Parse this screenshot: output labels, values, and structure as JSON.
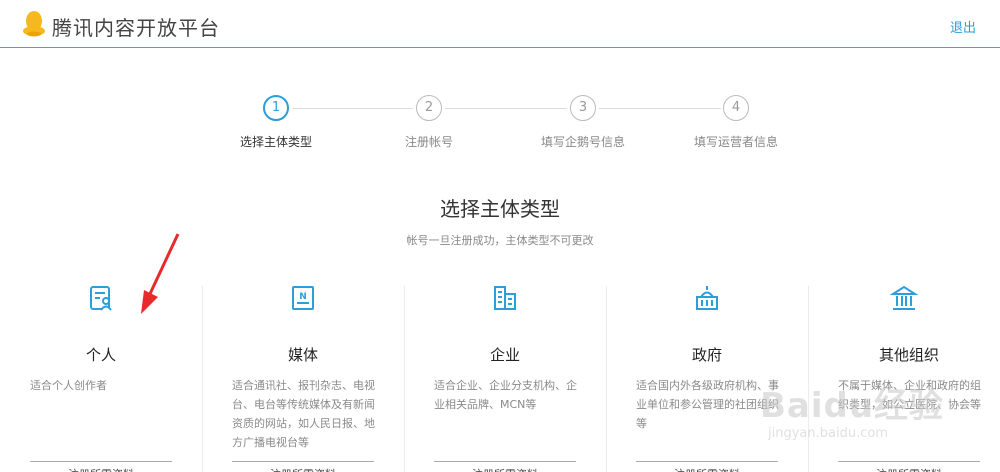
{
  "header": {
    "brand": "腾讯内容开放平台",
    "logout": "退出",
    "brand_color": "#f5b91f",
    "accent_color": "#2a9fd8"
  },
  "steps": [
    {
      "num": "1",
      "label": "选择主体类型",
      "active": true
    },
    {
      "num": "2",
      "label": "注册帐号",
      "active": false
    },
    {
      "num": "3",
      "label": "填写企鹅号信息",
      "active": false
    },
    {
      "num": "4",
      "label": "填写运营者信息",
      "active": false
    }
  ],
  "section": {
    "title": "选择主体类型",
    "subtitle": "帐号一旦注册成功，主体类型不可更改"
  },
  "cards": [
    {
      "icon": "personal-id-card-icon",
      "name": "个人",
      "desc": "适合个人创作者",
      "button": "注册所需资料"
    },
    {
      "icon": "media-newspaper-icon",
      "name": "媒体",
      "desc": "适合通讯社、报刊杂志、电视台、电台等传统媒体及有新闻资质的网站，如人民日报、地方广播电视台等",
      "button": "注册所需资料"
    },
    {
      "icon": "enterprise-building-icon",
      "name": "企业",
      "desc": "适合企业、企业分支机构、企业相关品牌、MCN等",
      "button": "注册所需资料"
    },
    {
      "icon": "government-building-icon",
      "name": "政府",
      "desc": "适合国内外各级政府机构、事业单位和参公管理的社团组织等",
      "button": "注册所需资料"
    },
    {
      "icon": "institution-pillars-icon",
      "name": "其他组织",
      "desc": "不属于媒体、企业和政府的组织类型，如公立医院、协会等",
      "button": "注册所需资料"
    }
  ],
  "annotation": {
    "icon": "red-arrow-icon"
  },
  "watermark": {
    "big": "Baidu经验",
    "small": "jingyan.baidu.com"
  }
}
